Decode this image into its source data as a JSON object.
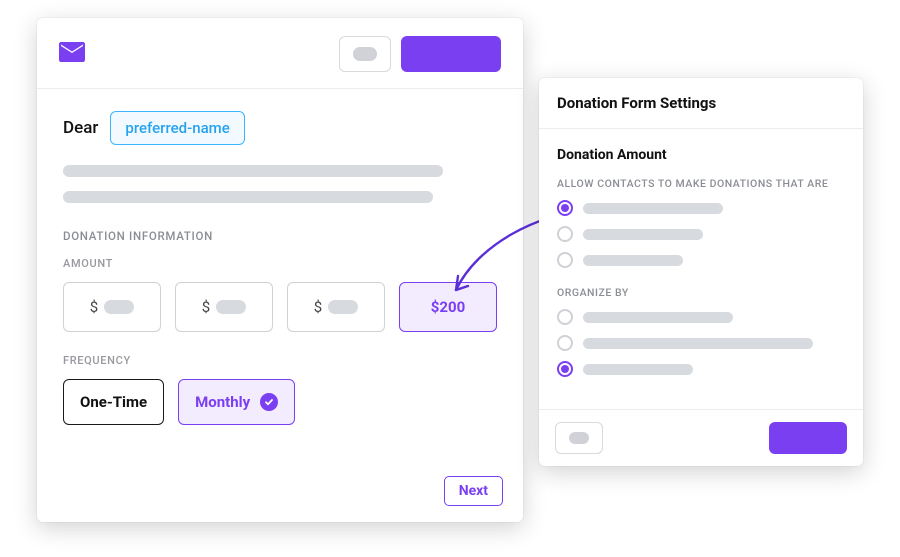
{
  "form": {
    "salutation_word": "Dear",
    "merge_field": "preferred-name",
    "sections": {
      "donation_info": "DONATION INFORMATION",
      "amount": "AMOUNT",
      "frequency": "FREQUENCY"
    },
    "amounts": {
      "currency_symbol": "$",
      "selected_label": "$200"
    },
    "frequency": {
      "one_time": "One-Time",
      "monthly": "Monthly"
    },
    "next_button": "Next"
  },
  "settings": {
    "title": "Donation Form Settings",
    "group_title": "Donation Amount",
    "allow_label": "ALLOW CONTACTS TO MAKE DONATIONS THAT ARE",
    "organize_label": "ORGANIZE BY"
  },
  "colors": {
    "accent": "#7b3ff2",
    "link": "#27a3ee"
  }
}
